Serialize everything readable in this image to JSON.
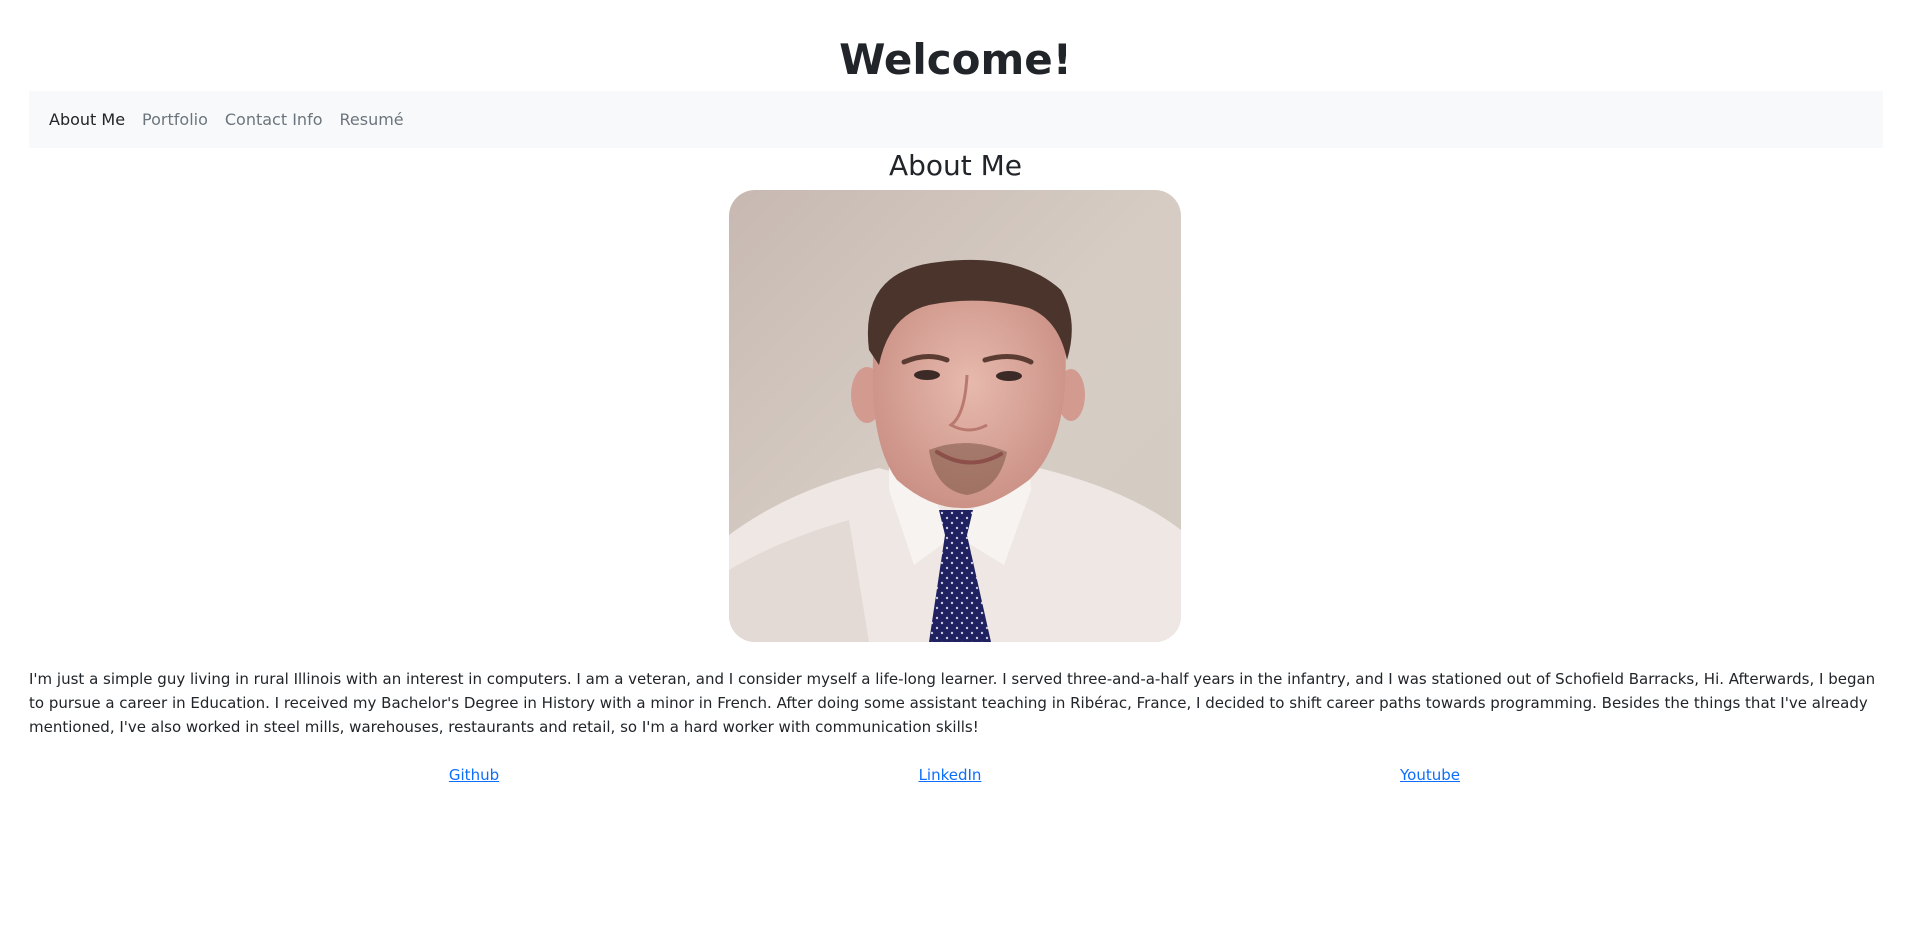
{
  "header": {
    "title": "Welcome!"
  },
  "nav": {
    "items": [
      {
        "label": "About Me",
        "active": true
      },
      {
        "label": "Portfolio",
        "active": false
      },
      {
        "label": "Contact Info",
        "active": false
      },
      {
        "label": "Resumé",
        "active": false
      }
    ]
  },
  "about": {
    "heading": "About Me",
    "photo_icon": "portrait-photo",
    "bio": "I'm just a simple guy living in rural Illinois with an interest in computers. I am a veteran, and I consider myself a life-long learner. I served three-and-a-half years in the infantry, and I was stationed out of Schofield Barracks, Hi. Afterwards, I began to pursue a career in Education. I received my Bachelor's Degree in History with a minor in French. After doing some assistant teaching in Ribérac, France, I decided to shift career paths towards programming. Besides the things that I've already mentioned, I've also worked in steel mills, warehouses, restaurants and retail, so I'm a hard worker with communication skills!"
  },
  "links": {
    "github": "Github",
    "linkedin": "LinkedIn",
    "youtube": "Youtube"
  },
  "colors": {
    "link": "#0d6efd",
    "navbar_bg": "#f8f9fa",
    "text": "#212529",
    "nav_muted": "#6c757d"
  }
}
